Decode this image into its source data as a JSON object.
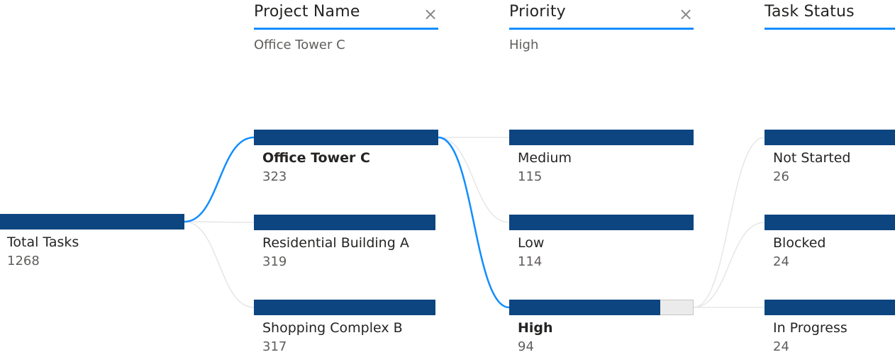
{
  "root": {
    "label": "Total Tasks",
    "value": "1268",
    "fraction": 1.0
  },
  "levels": [
    {
      "header": "Project Name",
      "filter": "Office Tower C",
      "closable": true,
      "nodes": [
        {
          "label": "Office Tower C",
          "value": "323",
          "fraction": 1.0,
          "selected": true
        },
        {
          "label": "Residential Building A",
          "value": "319",
          "fraction": 1.0,
          "selected": false
        },
        {
          "label": "Shopping Complex B",
          "value": "317",
          "fraction": 1.0,
          "selected": false
        }
      ]
    },
    {
      "header": "Priority",
      "filter": "High",
      "closable": true,
      "nodes": [
        {
          "label": "Medium",
          "value": "115",
          "fraction": 1.0,
          "selected": false
        },
        {
          "label": "Low",
          "value": "114",
          "fraction": 1.0,
          "selected": false
        },
        {
          "label": "High",
          "value": "94",
          "fraction": 0.82,
          "selected": true
        }
      ]
    },
    {
      "header": "Task Status",
      "filter": "",
      "closable": false,
      "nodes": [
        {
          "label": "Not Started",
          "value": "26",
          "fraction": 1.0,
          "selected": false
        },
        {
          "label": "Blocked",
          "value": "24",
          "fraction": 1.0,
          "selected": false
        },
        {
          "label": "In Progress",
          "value": "24",
          "fraction": 1.0,
          "selected": false
        }
      ]
    }
  ],
  "icons": {
    "close": "close-icon"
  },
  "colors": {
    "bar": "#0C4580",
    "accent": "#118DFF",
    "connector": "#E6E6E6",
    "bar_remainder": "#EBEBEB"
  }
}
